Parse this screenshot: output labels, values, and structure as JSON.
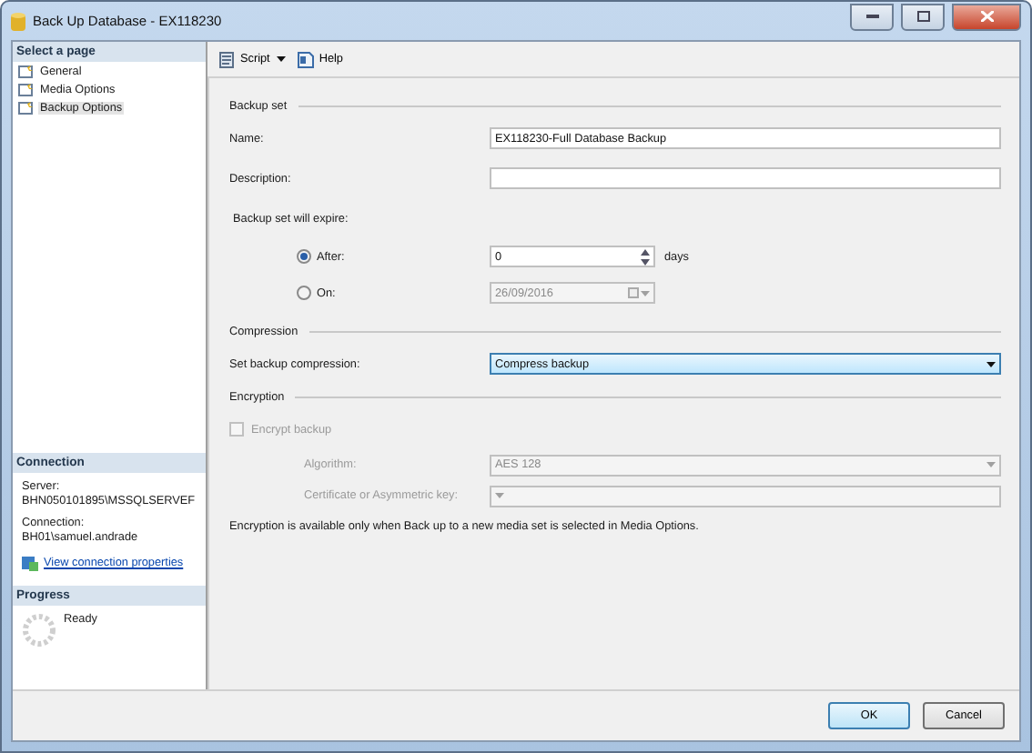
{
  "window": {
    "title": "Back Up Database - EX118230"
  },
  "sidebar": {
    "header": "Select a page",
    "pages": [
      {
        "label": "General",
        "selected": false
      },
      {
        "label": "Media Options",
        "selected": false
      },
      {
        "label": "Backup Options",
        "selected": true
      }
    ],
    "connection": {
      "header": "Connection",
      "server_label": "Server:",
      "server": "BHN050101895\\MSSQLSERVEF",
      "connection_label": "Connection:",
      "connection": "BH01\\samuel.andrade",
      "link": "View connection properties"
    },
    "progress": {
      "header": "Progress",
      "status": "Ready"
    }
  },
  "toolbar": [
    {
      "label": "Script",
      "kind": "dropdown"
    },
    {
      "label": "Help",
      "kind": "button"
    }
  ],
  "backup_set": {
    "heading": "Backup set",
    "name_label": "Name:",
    "name": "EX118230-Full Database Backup",
    "description_label": "Description:",
    "expire_label": "Backup set will expire:",
    "expire_options": [
      {
        "label": "After:",
        "selected": true,
        "kind": "spin",
        "value": "0",
        "unit": "days"
      },
      {
        "label": "On:",
        "selected": false,
        "kind": "date",
        "value": "26/09/2016"
      }
    ]
  },
  "compression": {
    "heading": "Compression",
    "label": "Set backup compression:",
    "value": "Compress backup"
  },
  "encryption": {
    "heading": "Encryption",
    "checkbox": {
      "label": "Encrypt backup",
      "checked": false,
      "disabled": true
    },
    "fields": [
      {
        "label": "Algorithm:",
        "value": "AES 128",
        "disabled": true
      },
      {
        "label": "Certificate or Asymmetric key:",
        "disabled": true
      }
    ],
    "note": "Encryption is available only when Back up to a new media set is selected in Media Options."
  },
  "buttons": [
    {
      "label": "OK",
      "default": true
    },
    {
      "label": "Cancel",
      "default": false
    }
  ]
}
